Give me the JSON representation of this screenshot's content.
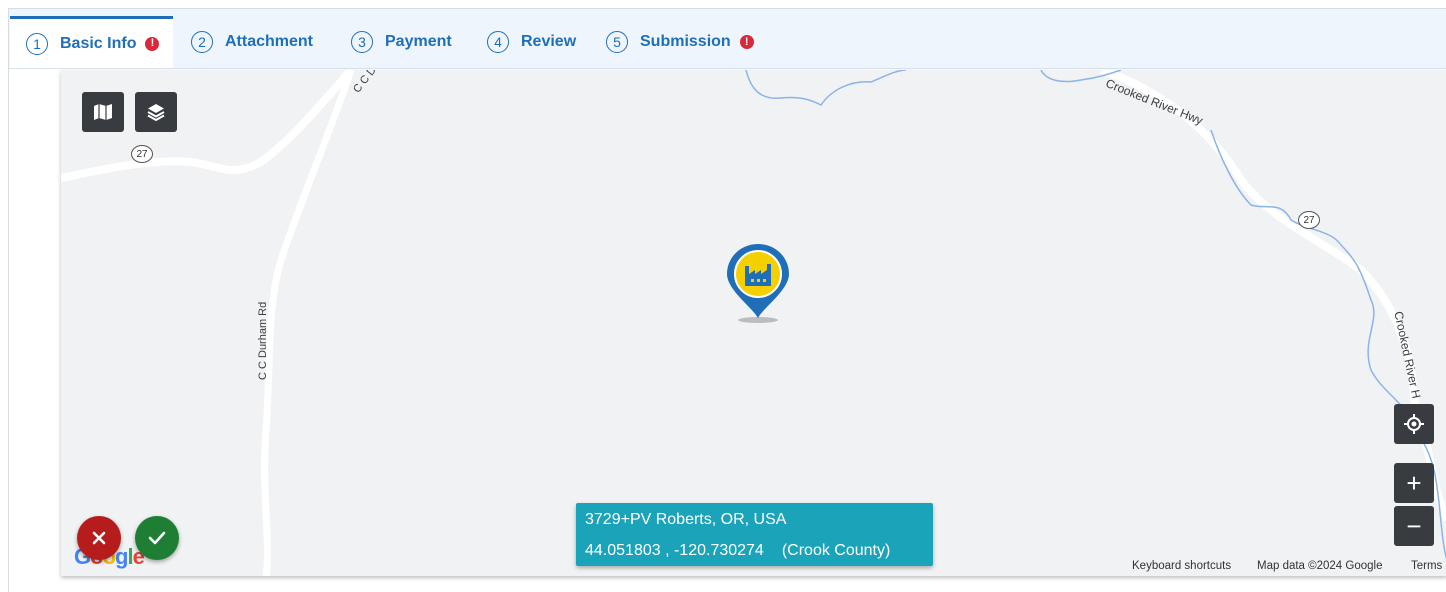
{
  "tabs": [
    {
      "number": "1",
      "label": "Basic Info",
      "alert": "!"
    },
    {
      "number": "2",
      "label": "Attachment"
    },
    {
      "number": "3",
      "label": "Payment"
    },
    {
      "number": "4",
      "label": "Review"
    },
    {
      "number": "5",
      "label": "Submission",
      "alert": "!"
    }
  ],
  "map": {
    "road_labels": {
      "cc_durham_top": "C C Durha",
      "cc_durham_rd": "C C Durham Rd",
      "crooked_river_hwy_top": "Crooked River Hwy",
      "crooked_river_hwy_right": "Crooked River H"
    },
    "route_shields": [
      "27",
      "27"
    ],
    "info": {
      "address": "3729+PV Roberts, OR, USA",
      "coordinates": "44.051803 , -120.730274",
      "county": "(Crook County)"
    },
    "attribution": {
      "keyboard": "Keyboard shortcuts",
      "map_data": "Map data ©2024 Google",
      "terms": "Terms"
    },
    "google_logo": "Google",
    "controls": {
      "zoom_in": "+",
      "zoom_out": "−"
    }
  },
  "colors": {
    "tab_accent": "#1f6fb8",
    "alert": "#d8283b",
    "info_box": "#1aa3b9",
    "cancel": "#b71c1c",
    "confirm": "#1e7e34",
    "marker": "#1f6fb8",
    "marker_inner": "#f5d000"
  }
}
